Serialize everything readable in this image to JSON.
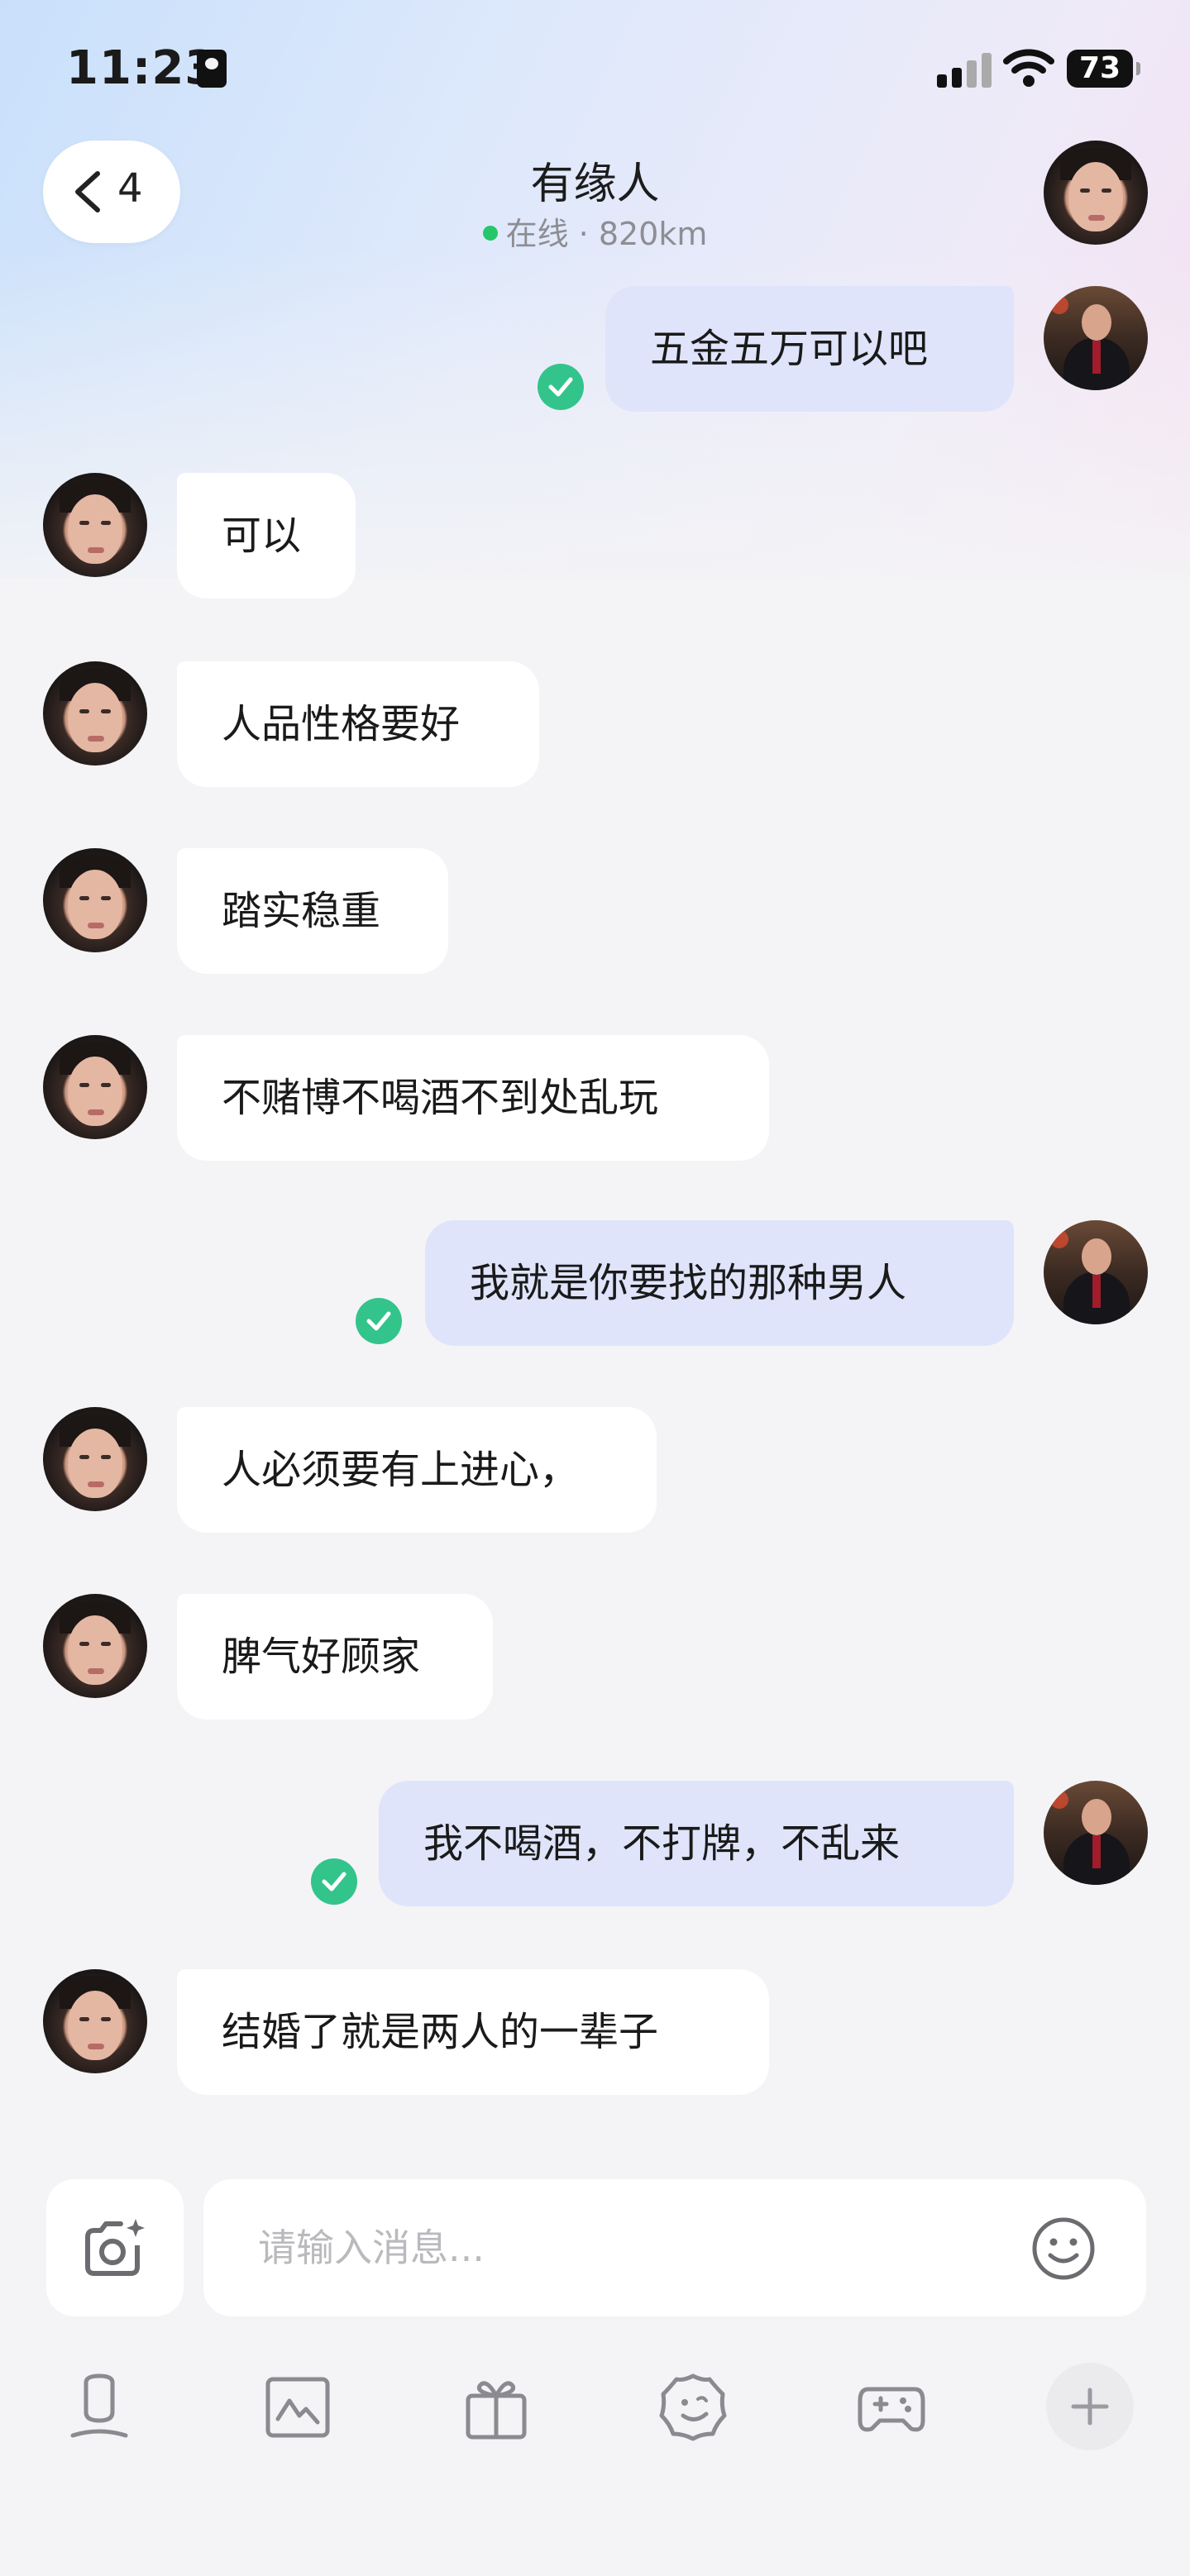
{
  "status_bar": {
    "time": "11:23",
    "battery": "73"
  },
  "header": {
    "back_count": "4",
    "title": "有缘人",
    "online_text": "在线 · 820km"
  },
  "messages": [
    {
      "from": "me",
      "text": "五金五万可以吧",
      "read": true
    },
    {
      "from": "her",
      "text": "可以"
    },
    {
      "from": "her",
      "text": "人品性格要好"
    },
    {
      "from": "her",
      "text": "踏实稳重"
    },
    {
      "from": "her",
      "text": "不赌博不喝酒不到处乱玩"
    },
    {
      "from": "me",
      "text": "我就是你要找的那种男人",
      "read": true
    },
    {
      "from": "her",
      "text": "人必须要有上进心，"
    },
    {
      "from": "her",
      "text": "脾气好顾家"
    },
    {
      "from": "me",
      "text": "我不喝酒，不打牌，不乱来",
      "read": true
    },
    {
      "from": "her",
      "text": "结婚了就是两人的一辈子"
    }
  ],
  "input": {
    "placeholder": "请输入消息..."
  },
  "toolbar": {
    "icons": [
      "voice-icon",
      "photo-icon",
      "gift-icon",
      "sticker-icon",
      "game-icon",
      "plus-icon"
    ]
  },
  "colors": {
    "outgoing_bubble": "#dfe4fb",
    "incoming_bubble": "#ffffff",
    "read_check": "#33c48c",
    "online_dot": "#26c66a"
  }
}
